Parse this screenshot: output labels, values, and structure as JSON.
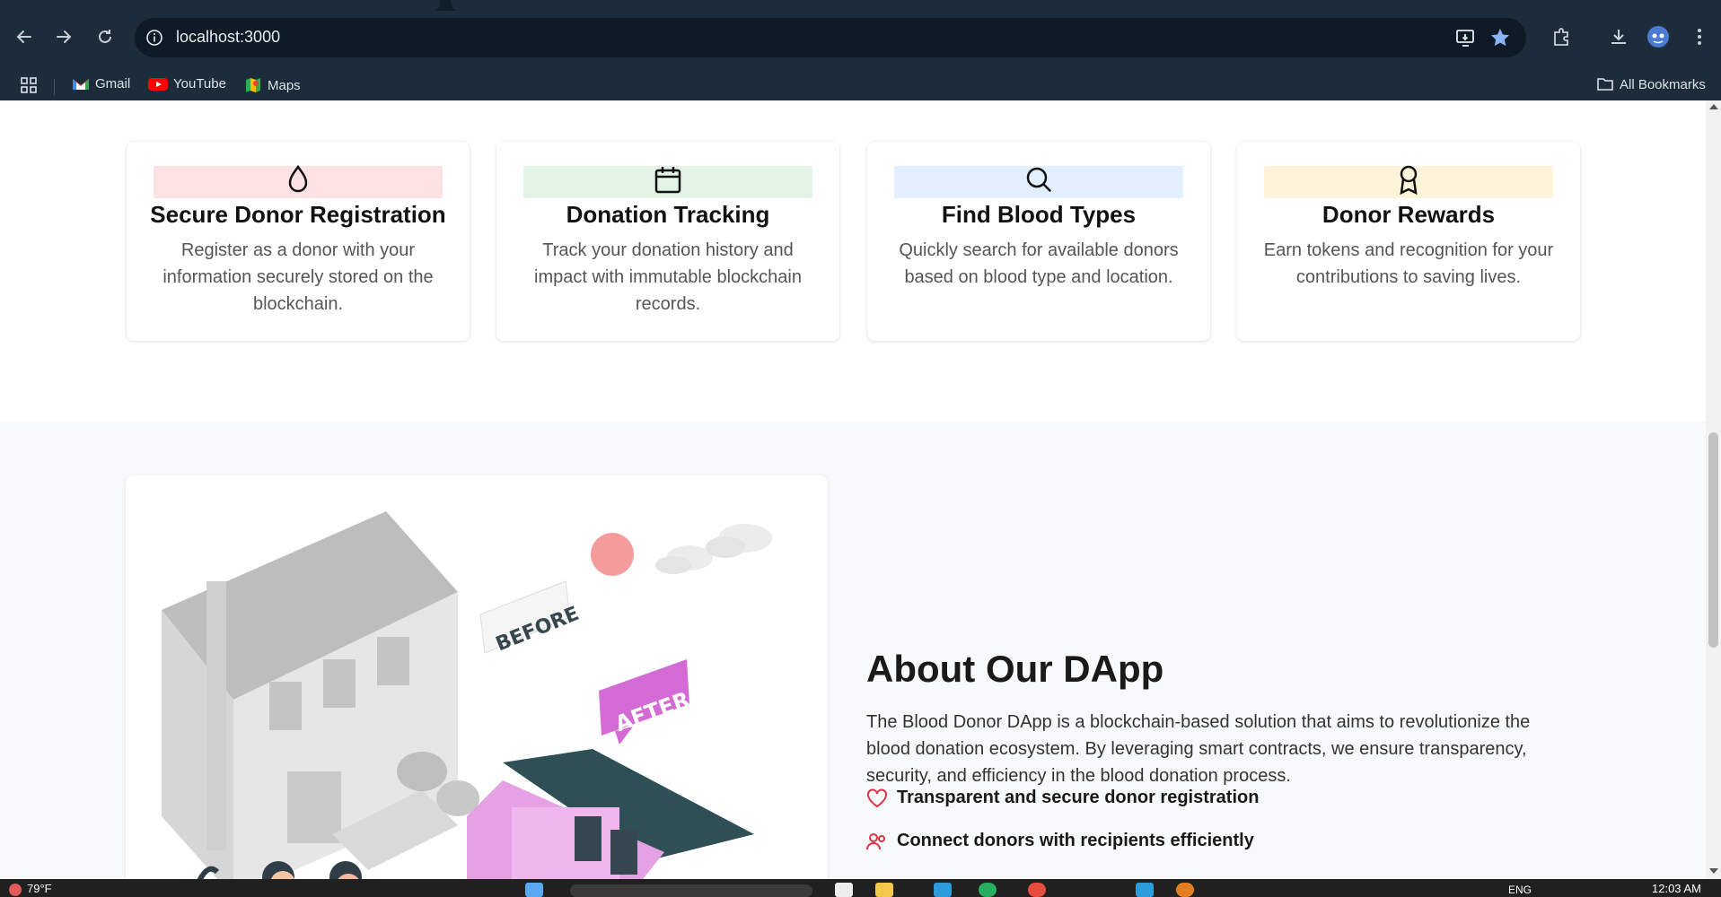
{
  "browser": {
    "url": "localhost:3000",
    "bookmarks": [
      {
        "label": "Gmail",
        "icon": "gmail-icon"
      },
      {
        "label": "YouTube",
        "icon": "youtube-icon"
      },
      {
        "label": "Maps",
        "icon": "maps-icon"
      }
    ],
    "all_bookmarks_label": "All Bookmarks"
  },
  "features": [
    {
      "title": "Secure Donor Registration",
      "text": "Register as a donor with your information securely stored on the blockchain.",
      "icon": "drop-icon",
      "band_color": "#fde2e4"
    },
    {
      "title": "Donation Tracking",
      "text": "Track your donation history and impact with immutable blockchain records.",
      "icon": "calendar-icon",
      "band_color": "#e3f3e6"
    },
    {
      "title": "Find Blood Types",
      "text": "Quickly search for available donors based on blood type and location.",
      "icon": "search-icon",
      "band_color": "#e1efff"
    },
    {
      "title": "Donor Rewards",
      "text": "Earn tokens and recognition for your contributions to saving lives.",
      "icon": "award-icon",
      "band_color": "#fdf4d9"
    }
  ],
  "about": {
    "title": "About Our DApp",
    "description": "The Blood Donor DApp is a blockchain-based solution that aims to revolutionize the blood donation ecosystem. By leveraging smart contracts, we ensure transparency, security, and efficiency in the blood donation process.",
    "features": [
      {
        "label": "Transparent and secure donor registration",
        "icon": "heart-icon"
      },
      {
        "label": "Connect donors with recipients efficiently",
        "icon": "users-icon"
      }
    ],
    "illustration": {
      "before_label": "BEFORE",
      "after_label": "AFTER"
    }
  },
  "taskbar": {
    "weather": "79°F",
    "language": "ENG",
    "time": "12:03 AM"
  },
  "colors": {
    "accent_red": "#dc3545",
    "after_pink": "#d36ad6",
    "chrome_bg": "#1c2c3a"
  }
}
